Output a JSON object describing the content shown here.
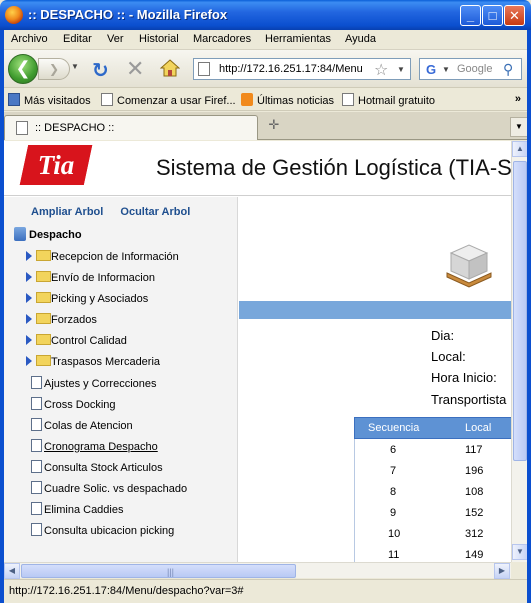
{
  "window": {
    "title": ":: DESPACHO :: - Mozilla Firefox",
    "minimize": "_",
    "maximize": "□",
    "close": "✕"
  },
  "menu": [
    "Archivo",
    "Editar",
    "Ver",
    "Historial",
    "Marcadores",
    "Herramientas",
    "Ayuda"
  ],
  "nav": {
    "url": "http://172.16.251.17:84/Menu",
    "search_placeholder": "Google"
  },
  "bookmarks": [
    "Más visitados",
    "Comenzar a usar Firef...",
    "Últimas noticias",
    "Hotmail gratuito"
  ],
  "tab": {
    "label": ":: DESPACHO ::"
  },
  "header": {
    "logo": "Tia",
    "title": "Sistema de Gestión Logística (TIA-SG"
  },
  "sidebar": {
    "links": [
      "Ampliar Arbol",
      "Ocultar Arbol"
    ],
    "root": "Despacho",
    "folders": [
      "Recepcion de Información",
      "Envío de Informacion",
      "Picking y Asociados",
      "Forzados",
      "Control Calidad",
      "Traspasos Mercaderia"
    ],
    "pages": [
      "Ajustes y Correcciones",
      "Cross Docking",
      "Colas de Atencion",
      "Cronograma Despacho",
      "Consulta Stock Articulos",
      "Cuadre Solic. vs despachado",
      "Elimina Caddies",
      "Consulta ubicacion picking"
    ]
  },
  "main": {
    "fields": [
      "Dia:",
      "Local:",
      "Hora Inicio:",
      "Transportista"
    ],
    "grid": {
      "headers": [
        "Secuencia",
        "Local"
      ],
      "rows": [
        [
          "6",
          "117"
        ],
        [
          "7",
          "196"
        ],
        [
          "8",
          "108"
        ],
        [
          "9",
          "152"
        ],
        [
          "10",
          "312"
        ],
        [
          "11",
          "149"
        ]
      ]
    }
  },
  "status": {
    "text": "http://172.16.251.17:84/Menu/despacho?var=3#"
  },
  "colors": {
    "title_bar": "#0b4fcf",
    "tia_red": "#d8141c",
    "grid_header": "#5e92d4"
  }
}
